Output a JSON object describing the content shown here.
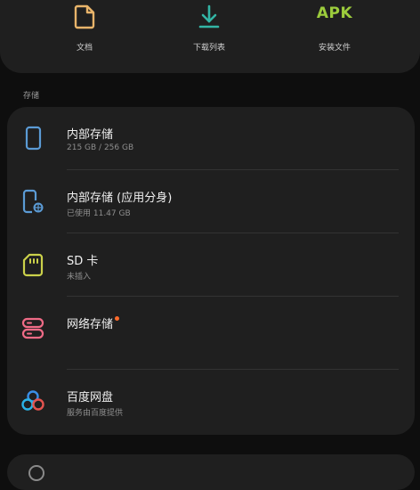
{
  "quick_access": [
    {
      "label": "文档",
      "icon": "document-icon",
      "color": "#e8b46a"
    },
    {
      "label": "下载列表",
      "icon": "download-icon",
      "color": "#33b5a5"
    },
    {
      "label": "安装文件",
      "icon": "apk-icon",
      "icon_text": "APK",
      "color": "#9ccc3c"
    }
  ],
  "storage": {
    "section_label": "存储",
    "items": [
      {
        "title": "内部存储",
        "subtitle": "215 GB / 256 GB",
        "icon": "phone-icon",
        "color": "#5b9bd5"
      },
      {
        "title": "内部存储 (应用分身)",
        "subtitle": "已使用 11.47 GB",
        "icon": "dual-app-phone-icon",
        "color": "#5b9bd5"
      },
      {
        "title": "SD 卡",
        "subtitle": "未插入",
        "icon": "sd-card-icon",
        "color": "#cbd14a"
      },
      {
        "title": "网络存储",
        "subtitle": "",
        "icon": "network-storage-icon",
        "color": "#ef6b86",
        "badge": true
      },
      {
        "title": "百度网盘",
        "subtitle": "服务由百度提供",
        "icon": "baidu-cloud-icon",
        "color": "#3a8ee6"
      }
    ]
  }
}
